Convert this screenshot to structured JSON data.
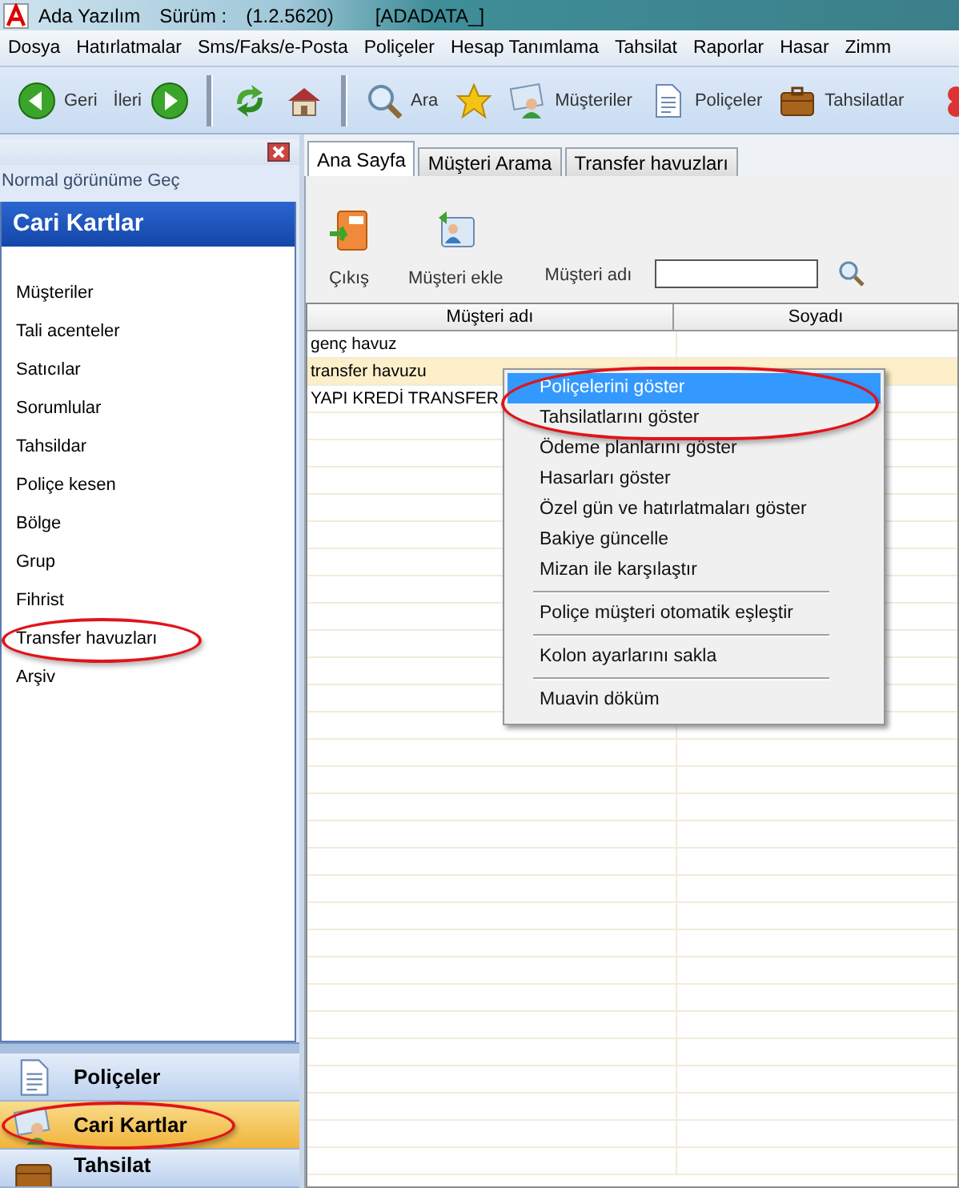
{
  "window": {
    "title_parts": [
      "Ada Yazılım",
      "Sürüm :",
      "(1.2.5620)",
      "[ADADATA_]"
    ]
  },
  "menu_bar": [
    "Dosya",
    "Hatırlatmalar",
    "Sms/Faks/e-Posta",
    "Poliçeler",
    "Hesap Tanımlama",
    "Tahsilat",
    "Raporlar",
    "Hasar",
    "Zimm"
  ],
  "toolbar": [
    {
      "kind": "back",
      "label": "Geri"
    },
    {
      "kind": "forward",
      "label": "İleri"
    },
    {
      "kind": "separator"
    },
    {
      "kind": "refresh"
    },
    {
      "kind": "home"
    },
    {
      "kind": "separator"
    },
    {
      "kind": "search",
      "label": "Ara"
    },
    {
      "kind": "star"
    },
    {
      "kind": "customers",
      "label": "Müşteriler"
    },
    {
      "kind": "document",
      "label": "Poliçeler"
    },
    {
      "kind": "briefcase",
      "label": "Tahsilatlar"
    },
    {
      "kind": "partial"
    }
  ],
  "sidebar": {
    "view_toggle": "Normal görünüme Geç",
    "title": "Cari Kartlar",
    "items": [
      {
        "label": "Müşteriler",
        "circled": false
      },
      {
        "label": "Tali acenteler",
        "circled": false
      },
      {
        "label": "Satıcılar",
        "circled": false
      },
      {
        "label": "Sorumlular",
        "circled": false
      },
      {
        "label": "Tahsildar",
        "circled": false
      },
      {
        "label": "Poliçe kesen",
        "circled": false
      },
      {
        "label": "Bölge",
        "circled": false
      },
      {
        "label": "Grup",
        "circled": false
      },
      {
        "label": "Fihrist",
        "circled": false
      },
      {
        "label": "Transfer havuzları",
        "circled": true
      },
      {
        "label": "Arşiv",
        "circled": false
      }
    ],
    "nav": [
      {
        "kind": "document",
        "label": "Poliçeler",
        "selected": false,
        "circled": false
      },
      {
        "kind": "customers",
        "label": "Cari Kartlar",
        "selected": true,
        "circled": true
      },
      {
        "kind": "briefcase",
        "label": "Tahsilat",
        "selected": false,
        "circled": false
      }
    ]
  },
  "tabs": [
    {
      "label": "Ana Sayfa",
      "selected": true
    },
    {
      "label": "Müşteri Arama",
      "selected": false
    },
    {
      "label": "Transfer havuzları",
      "selected": false
    }
  ],
  "page_toolbar": {
    "buttons": [
      {
        "kind": "exit",
        "label": "Çıkış"
      },
      {
        "kind": "add-customer",
        "label": "Müşteri ekle"
      }
    ],
    "search_label": "Müşteri adı"
  },
  "grid": {
    "columns": [
      "Müşteri adı",
      "Soyadı"
    ],
    "rows": [
      {
        "name": "genç havuz",
        "selected": false
      },
      {
        "name": "transfer havuzu",
        "selected": true
      },
      {
        "name": "YAPI KREDİ TRANSFER",
        "selected": false
      }
    ]
  },
  "context_menu": {
    "groups": [
      [
        {
          "label": "Poliçelerini göster",
          "highlighted": true,
          "circled": true
        },
        {
          "label": "Tahsilatlarını göster",
          "highlighted": false,
          "circled": true
        },
        {
          "label": "Ödeme planlarını göster",
          "highlighted": false,
          "circled": false
        },
        {
          "label": "Hasarları göster",
          "highlighted": false,
          "circled": false
        },
        {
          "label": "Özel gün ve hatırlatmaları göster",
          "highlighted": false,
          "circled": false
        },
        {
          "label": "Bakiye güncelle",
          "highlighted": false,
          "circled": false
        },
        {
          "label": "Mizan ile karşılaştır",
          "highlighted": false,
          "circled": false
        }
      ],
      [
        {
          "label": "Poliçe müşteri otomatik eşleştir",
          "highlighted": false,
          "circled": false
        }
      ],
      [
        {
          "label": "Kolon ayarlarını sakla",
          "highlighted": false,
          "circled": false
        }
      ],
      [
        {
          "label": "Muavin döküm",
          "highlighted": false,
          "circled": false
        }
      ]
    ]
  }
}
